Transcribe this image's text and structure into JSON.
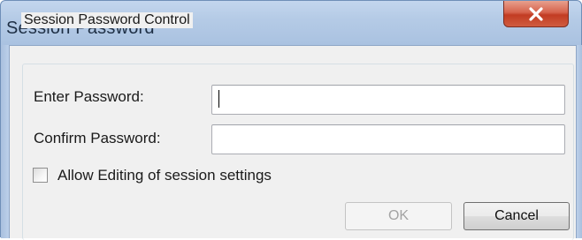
{
  "window": {
    "title": "Session Password"
  },
  "group": {
    "legend": "Session Password Control"
  },
  "fields": {
    "enter_label": "Enter Password:",
    "enter_value": "",
    "confirm_label": "Confirm Password:",
    "confirm_value": ""
  },
  "options": {
    "allow_editing_label": "Allow Editing of session settings",
    "allow_editing_checked": false
  },
  "buttons": {
    "ok_label": "OK",
    "ok_enabled": false,
    "cancel_label": "Cancel"
  },
  "icons": {
    "close": "close-icon"
  },
  "colors": {
    "title_text": "#1e2f45",
    "close_button": "#c23c23",
    "dialog_background": "#f0f0f0",
    "disabled_text": "#a3a3a3"
  }
}
